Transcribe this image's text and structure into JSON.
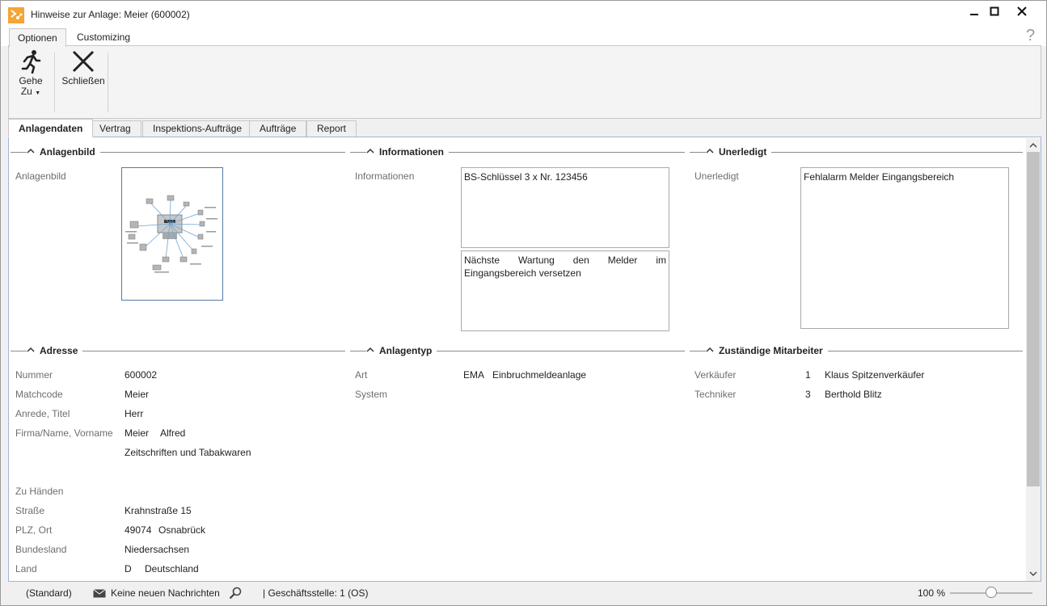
{
  "window": {
    "title": "Hinweise zur Anlage: Meier  (600002)",
    "brand_color": "#f4a535"
  },
  "ribbon_tabs": [
    {
      "label": "Optionen"
    },
    {
      "label": "Customizing"
    }
  ],
  "help": "?",
  "ribbon": {
    "goto_line1": "Gehe",
    "goto_line2": "Zu",
    "close_label": "Schließen"
  },
  "doc_tabs": [
    {
      "label": "Anlagendaten"
    },
    {
      "label": "Vertrag"
    },
    {
      "label": "Inspektions-Aufträge"
    },
    {
      "label": "Aufträge"
    },
    {
      "label": "Report"
    }
  ],
  "sections": {
    "anlagenbild": {
      "title": "Anlagenbild",
      "label": "Anlagenbild"
    },
    "informationen": {
      "title": "Informationen",
      "label": "Informationen",
      "text1": "BS-Schlüssel 3 x Nr. 123456",
      "text2": "Nächste Wartung den Melder im Eingangsbereich versetzen"
    },
    "unerledigt": {
      "title": "Unerledigt",
      "label": "Unerledigt",
      "text": "Fehlalarm Melder Eingangsbereich"
    },
    "adresse": {
      "title": "Adresse",
      "nummer_label": "Nummer",
      "nummer": "600002",
      "matchcode_label": "Matchcode",
      "matchcode": "Meier",
      "anrede_label": "Anrede, Titel",
      "anrede": "Herr",
      "firma_label": "Firma/Name, Vorname",
      "name": "Meier",
      "vorname": "Alfred",
      "firma2": "Zeitschriften und Tabakwaren",
      "zuhaenden_label": "Zu Händen",
      "strasse_label": "Straße",
      "strasse": "Krahnstraße 15",
      "plzort_label": "PLZ, Ort",
      "plz": "49074",
      "ort": "Osnabrück",
      "bundesland_label": "Bundesland",
      "bundesland": "Niedersachsen",
      "land_label": "Land",
      "land_code": "D",
      "land": "Deutschland"
    },
    "anlagentyp": {
      "title": "Anlagentyp",
      "art_label": "Art",
      "art_code": "EMA",
      "art": "Einbruchmeldeanlage",
      "system_label": "System"
    },
    "mitarbeiter": {
      "title": "Zuständige Mitarbeiter",
      "verkaeufer_label": "Verkäufer",
      "verkaeufer_nr": "1",
      "verkaeufer": "Klaus Spitzenverkäufer",
      "techniker_label": "Techniker",
      "techniker_nr": "3",
      "techniker": "Berthold Blitz"
    }
  },
  "status": {
    "standard": "(Standard)",
    "messages": "Keine neuen Nachrichten",
    "office": "| Geschäftsstelle:  1 (OS)",
    "zoom": "100 %",
    "zoom_level": 50
  }
}
